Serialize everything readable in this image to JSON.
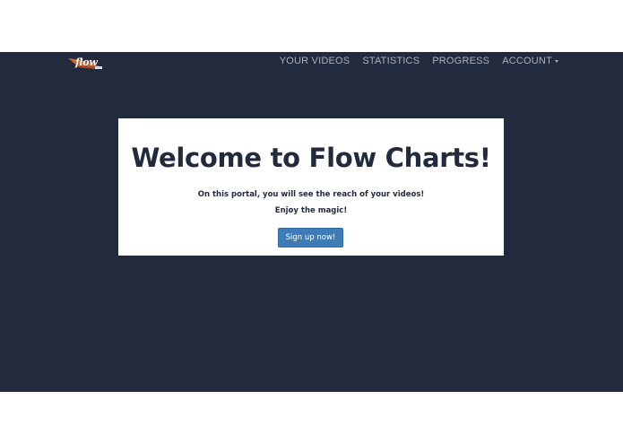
{
  "navbar": {
    "logo_text": "flow",
    "items": [
      {
        "label": "YOUR VIDEOS"
      },
      {
        "label": "STATISTICS"
      },
      {
        "label": "PROGRESS"
      },
      {
        "label": "ACCOUNT"
      }
    ]
  },
  "hero": {
    "title": "Welcome to Flow Charts!",
    "line1": "On this portal, you will see the reach of your videos!",
    "line2": "Enjoy the magic!",
    "button_label": "Sign up now!"
  },
  "colors": {
    "background": "#222b3d",
    "card": "#ffffff",
    "accent": "#3e7cb8",
    "nav_text": "#aab1bd",
    "logo_orange": "#e0622a"
  },
  "icons": {
    "logo": "flow-logo-icon",
    "account_caret": "caret-down-icon"
  }
}
